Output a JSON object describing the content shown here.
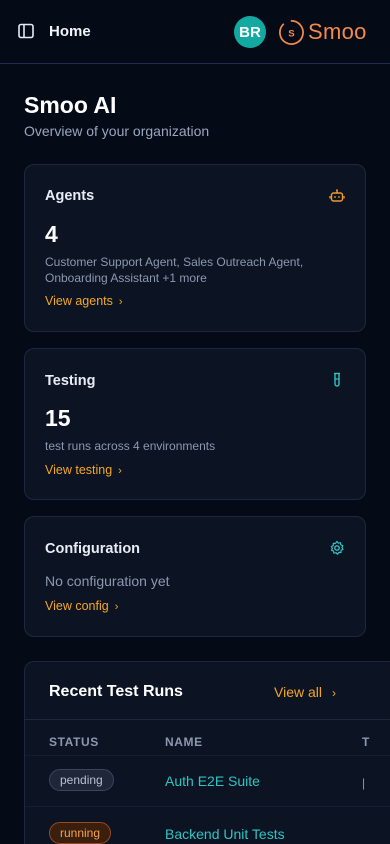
{
  "header": {
    "title": "Home",
    "avatar_initials": "BR",
    "brand_name": "Smoo",
    "brand_mark_letter": "S",
    "brand_color": "#f4894a"
  },
  "org": {
    "name": "Smoo AI",
    "subtitle": "Overview of your organization"
  },
  "cards": {
    "agents": {
      "title": "Agents",
      "icon": "robot-icon",
      "value": "4",
      "description": "Customer Support Agent, Sales Outreach Agent, Onboarding Assistant +1 more",
      "link": "View agents"
    },
    "testing": {
      "title": "Testing",
      "icon": "test-tube-icon",
      "value": "15",
      "description": "test runs across 4 environments",
      "link": "View testing"
    },
    "configuration": {
      "title": "Configuration",
      "icon": "gear-icon",
      "empty_text": "No configuration yet",
      "link": "View config"
    }
  },
  "recent_runs": {
    "title": "Recent Test Runs",
    "view_all": "View all",
    "columns": [
      "STATUS",
      "NAME",
      "T"
    ],
    "rows": [
      {
        "status": "pending",
        "name": "Auth E2E Suite"
      },
      {
        "status": "running",
        "name": "Backend Unit Tests"
      }
    ]
  },
  "colors": {
    "accent_orange": "#f5a623",
    "accent_teal": "#2ec4c0",
    "avatar_bg": "#13a8a0",
    "page_bg": "#050a17",
    "card_bg": "#0c1424"
  }
}
